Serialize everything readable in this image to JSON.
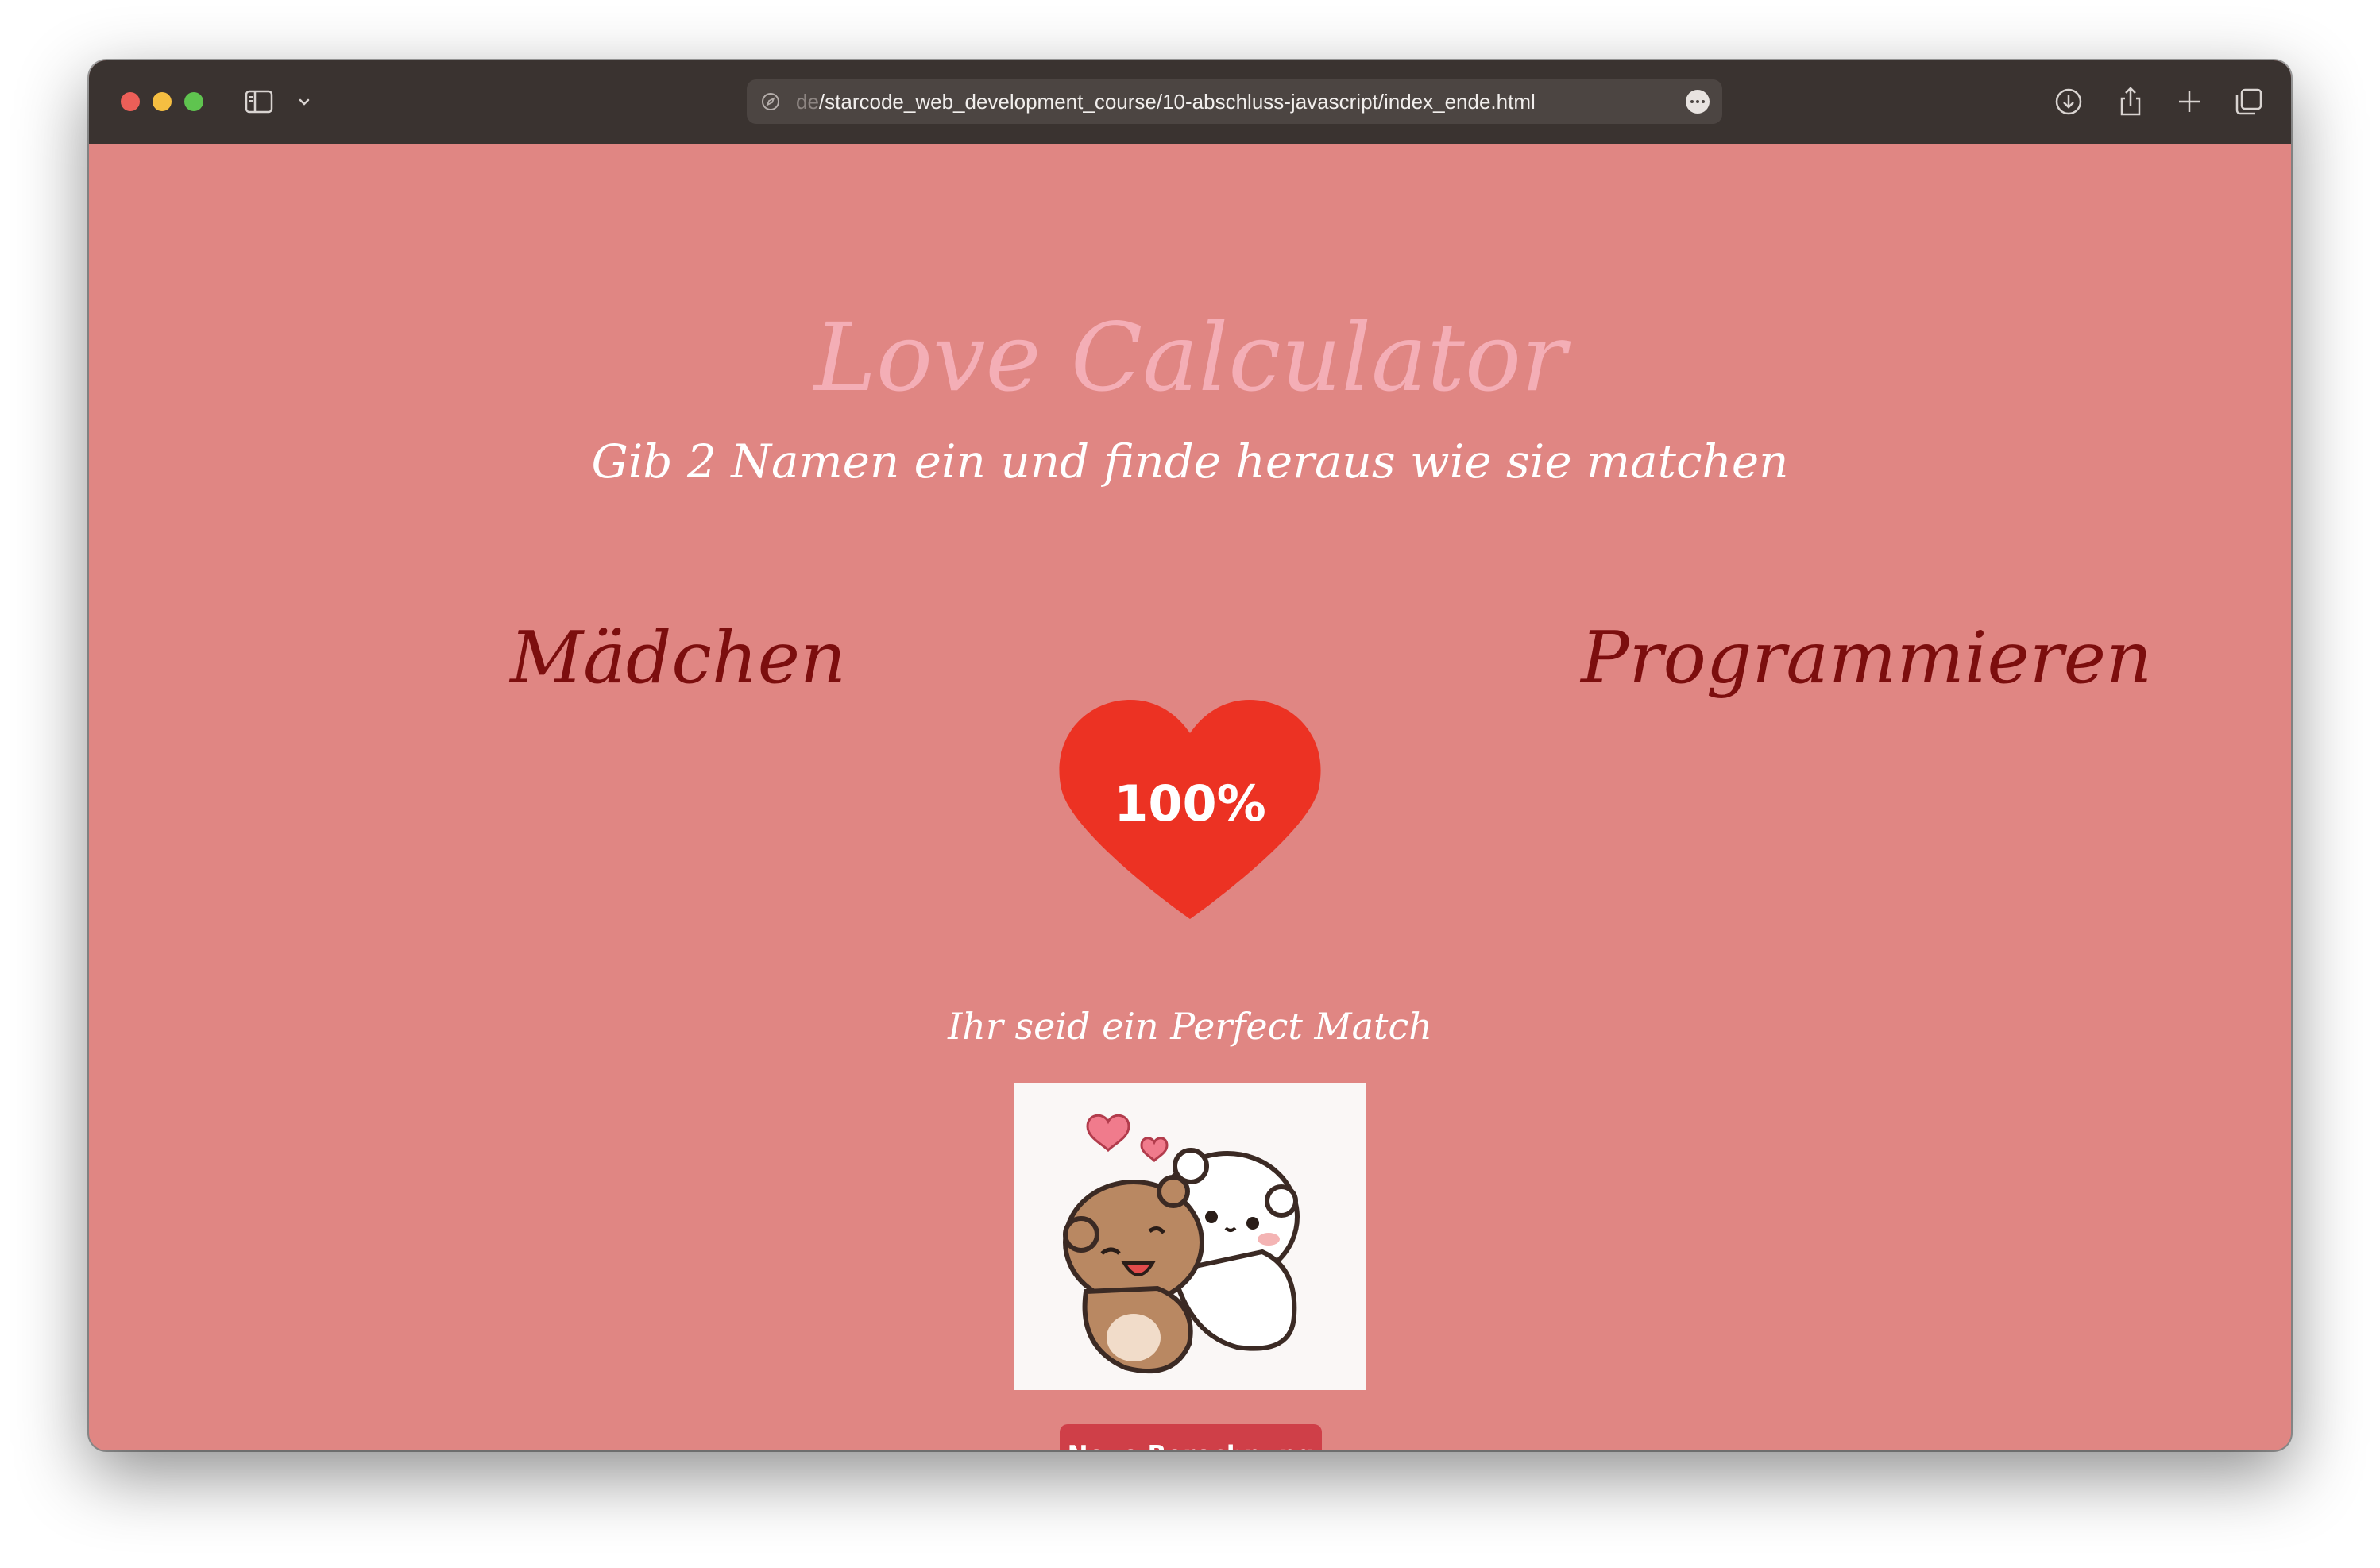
{
  "browser": {
    "url_prefix": "de",
    "url_path": "/starcode_web_development_course/10-abschluss-javascript/index_ende.html"
  },
  "page": {
    "title": "Love Calculator",
    "subtitle": "Gib 2 Namen ein und finde heraus wie sie matchen",
    "name_left": "Mädchen",
    "name_right": "Programmieren",
    "score": "100%",
    "score_value": 100,
    "result_message": "Ihr seid ein Perfect Match",
    "new_calc_button": "Neue Berechnung"
  },
  "colors": {
    "background": "#e08683",
    "heart": "#ec3223",
    "button": "#cf3f48",
    "title": "#f4aeb6",
    "names": "#7c0e0e"
  },
  "icons": [
    "sidebar-icon",
    "chevron-down-icon",
    "compass-icon",
    "more-icon",
    "download-icon",
    "share-icon",
    "plus-icon",
    "tabs-overview-icon",
    "heart-icon"
  ]
}
